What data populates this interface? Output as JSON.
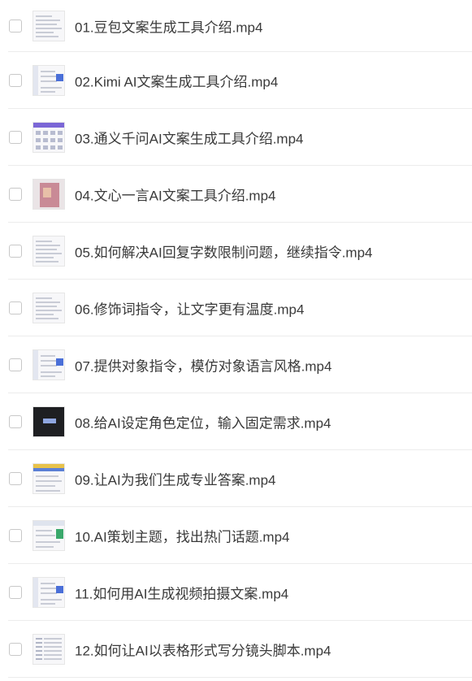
{
  "files": [
    {
      "name": "01.豆包文案生成工具介绍.mp4",
      "thumb": "doc"
    },
    {
      "name": "02.Kimi AI文案生成工具介绍.mp4",
      "thumb": "ui-blue"
    },
    {
      "name": "03.通义千问AI文案生成工具介绍.mp4",
      "thumb": "grid"
    },
    {
      "name": "04.文心一言AI文案工具介绍.mp4",
      "thumb": "image"
    },
    {
      "name": "05.如何解决AI回复字数限制问题，继续指令.mp4",
      "thumb": "doc"
    },
    {
      "name": "06.修饰词指令，让文字更有温度.mp4",
      "thumb": "doc"
    },
    {
      "name": "07.提供对象指令，模仿对象语言风格.mp4",
      "thumb": "ui-blue"
    },
    {
      "name": "08.给AI设定角色定位，输入固定需求.mp4",
      "thumb": "dark"
    },
    {
      "name": "09.让AI为我们生成专业答案.mp4",
      "thumb": "header-yellow"
    },
    {
      "name": "10.AI策划主题，找出热门话题.mp4",
      "thumb": "ui-green"
    },
    {
      "name": "11.如何用AI生成视频拍摄文案.mp4",
      "thumb": "ui-blue"
    },
    {
      "name": "12.如何让AI以表格形式写分镜头脚本.mp4",
      "thumb": "table"
    }
  ]
}
